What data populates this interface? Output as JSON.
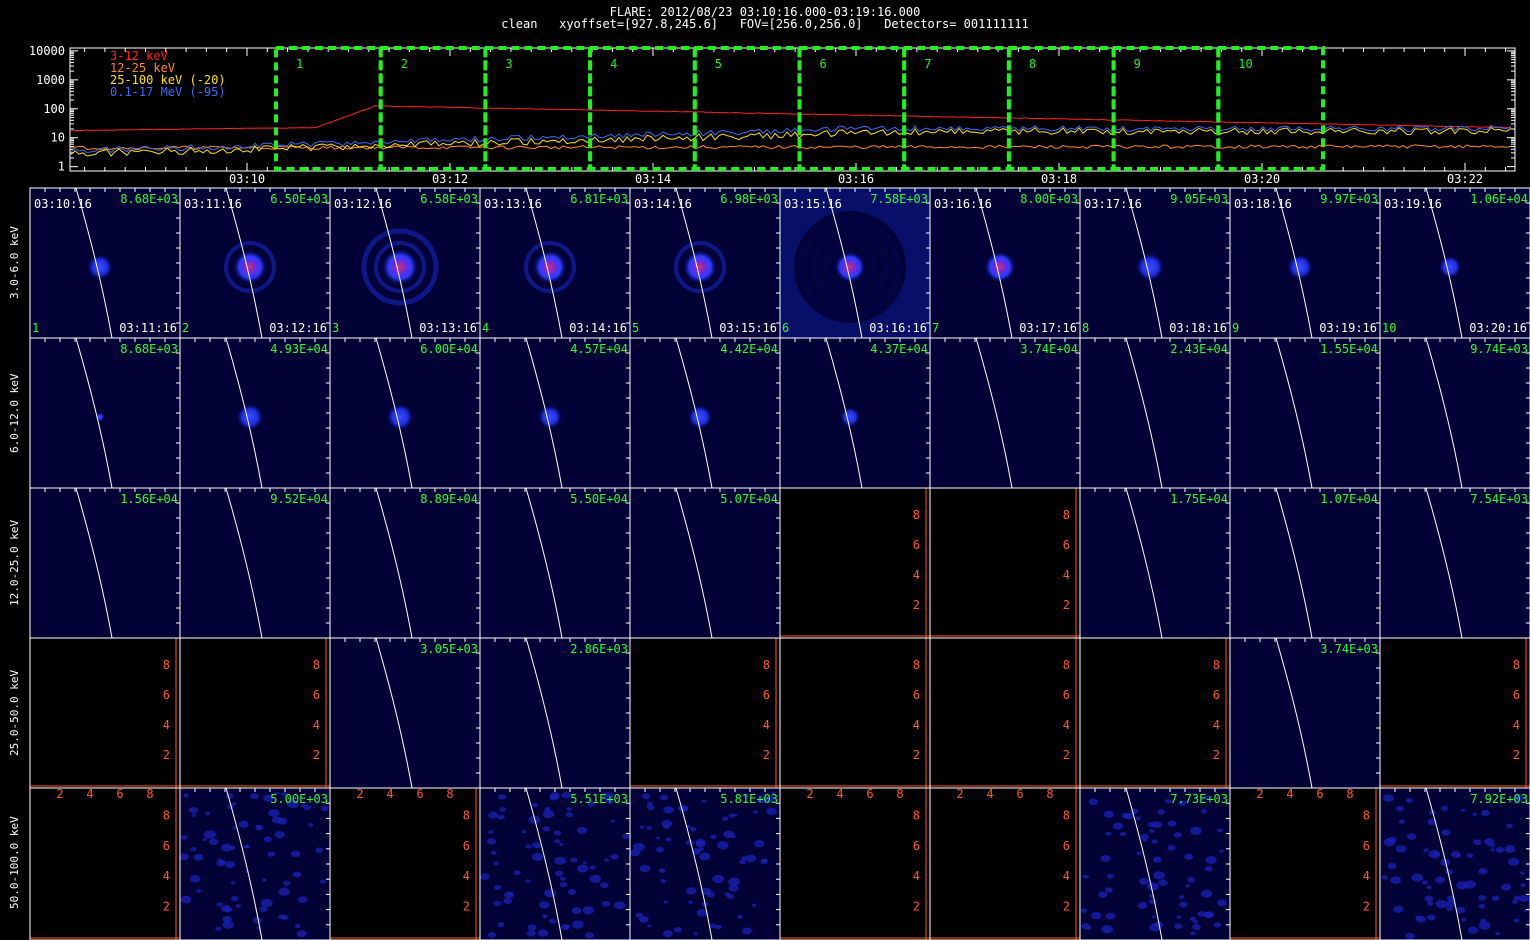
{
  "header": {
    "line1": "FLARE: 2012/08/23 03:10:16.000-03:19:16.000",
    "line2": "clean   xyoffset=[927.8,245.6]   FOV=[256.0,256.0]   Detectors= 001111111"
  },
  "lightcurve": {
    "ytick_labels": [
      "10000",
      "1000",
      "100",
      "10",
      "1"
    ],
    "xtick_labels": [
      "03:10",
      "03:12",
      "03:14",
      "03:16",
      "03:18",
      "03:20",
      "03:22"
    ],
    "legend": [
      {
        "label": "3-12 keV",
        "color": "#ff2020"
      },
      {
        "label": "12-25 keV",
        "color": "#ff8a1a"
      },
      {
        "label": "25-100 keV (-20)",
        "color": "#ffe000"
      },
      {
        "label": "0.1-17 MeV (-95)",
        "color": "#3a6bff"
      }
    ],
    "intervals": [
      "1",
      "2",
      "3",
      "4",
      "5",
      "6",
      "7",
      "8",
      "9",
      "10"
    ],
    "interval_color": "#22ee22"
  },
  "energy_bands": [
    "3.0-6.0 keV",
    "6.0-12.0 keV",
    "12.0-25.0 keV",
    "25.0-50.0 keV",
    "50.0-100.0 keV"
  ],
  "rows": [
    {
      "band": "3.0-6.0 keV",
      "cells": [
        {
          "start": "03:10:16",
          "end": "03:11:16",
          "idx": "1",
          "peak": "8.68E+03",
          "source": 0.9,
          "rings": 0
        },
        {
          "start": "03:11:16",
          "end": "03:12:16",
          "idx": "2",
          "peak": "6.50E+03",
          "source": 1.2,
          "rings": 1
        },
        {
          "start": "03:12:16",
          "end": "03:13:16",
          "idx": "3",
          "peak": "6.58E+03",
          "source": 1.3,
          "rings": 2
        },
        {
          "start": "03:13:16",
          "end": "03:14:16",
          "idx": "4",
          "peak": "6.81E+03",
          "source": 1.2,
          "rings": 1
        },
        {
          "start": "03:14:16",
          "end": "03:15:16",
          "idx": "5",
          "peak": "6.98E+03",
          "source": 1.2,
          "rings": 1
        },
        {
          "start": "03:15:16",
          "end": "03:16:16",
          "idx": "6",
          "peak": "7.58E+03",
          "source": 1.1,
          "rings": 3
        },
        {
          "start": "03:16:16",
          "end": "03:17:16",
          "idx": "7",
          "peak": "8.00E+03",
          "source": 1.1,
          "rings": 0
        },
        {
          "start": "03:17:16",
          "end": "03:18:16",
          "idx": "8",
          "peak": "9.05E+03",
          "source": 1.0,
          "rings": 0
        },
        {
          "start": "03:18:16",
          "end": "03:19:16",
          "idx": "9",
          "peak": "9.97E+03",
          "source": 0.9,
          "rings": 0
        },
        {
          "start": "03:19:16",
          "end": "03:20:16",
          "idx": "10",
          "peak": "1.06E+04",
          "source": 0.8,
          "rings": 0
        }
      ]
    },
    {
      "band": "6.0-12.0 keV",
      "cells": [
        {
          "peak": "8.68E+03",
          "source": 0.3
        },
        {
          "peak": "4.93E+04",
          "source": 0.95
        },
        {
          "peak": "6.00E+04",
          "source": 0.95
        },
        {
          "peak": "4.57E+04",
          "source": 0.85
        },
        {
          "peak": "4.42E+04",
          "source": 0.85
        },
        {
          "peak": "4.37E+04",
          "source": 0.7
        },
        {
          "peak": "3.74E+04",
          "source": 0.0
        },
        {
          "peak": "2.43E+04",
          "source": 0.0
        },
        {
          "peak": "1.55E+04",
          "source": 0.0
        },
        {
          "peak": "9.74E+03",
          "source": 0.0
        }
      ]
    },
    {
      "band": "12.0-25.0 keV",
      "cells": [
        {
          "peak": "1.56E+04"
        },
        {
          "peak": "9.52E+04"
        },
        {
          "peak": "8.89E+04"
        },
        {
          "peak": "5.50E+04"
        },
        {
          "peak": "5.07E+04"
        },
        {
          "peak": ""
        },
        {
          "peak": ""
        },
        {
          "peak": "1.75E+04"
        },
        {
          "peak": "1.07E+04"
        },
        {
          "peak": "7.54E+03"
        }
      ]
    },
    {
      "band": "25.0-50.0 keV",
      "cells": [
        {
          "peak": ""
        },
        {
          "peak": ""
        },
        {
          "peak": "3.05E+03"
        },
        {
          "peak": "2.86E+03"
        },
        {
          "peak": ""
        },
        {
          "peak": ""
        },
        {
          "peak": ""
        },
        {
          "peak": ""
        },
        {
          "peak": "3.74E+03"
        },
        {
          "peak": ""
        }
      ]
    },
    {
      "band": "50.0-100.0 keV",
      "cells": [
        {
          "peak": ""
        },
        {
          "peak": "5.00E+03",
          "noise": true
        },
        {
          "peak": ""
        },
        {
          "peak": "5.51E+03",
          "noise": true
        },
        {
          "peak": "5.81E+03",
          "noise": true
        },
        {
          "peak": ""
        },
        {
          "peak": ""
        },
        {
          "peak": "7.73E+03",
          "noise": true
        },
        {
          "peak": ""
        },
        {
          "peak": "7.92E+03",
          "noise": true
        }
      ]
    }
  ],
  "empty_axis_ticks": [
    "2",
    "4",
    "6",
    "8"
  ],
  "colors": {
    "map_background": "#020236",
    "empty_axis": "#ff5a1e",
    "peak_text": "#2cff2c",
    "limb": "#ffffff"
  }
}
